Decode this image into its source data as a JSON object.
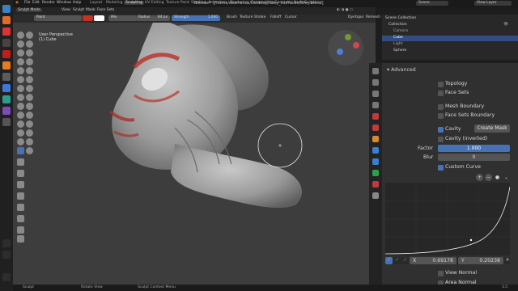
{
  "window": {
    "title": "Blender* [/home/ebarranco/Desktop/Grey_Isurfaces/Grey.blend]"
  },
  "menu": [
    "File",
    "Edit",
    "Render",
    "Window",
    "Help"
  ],
  "workspaces": [
    "Layout",
    "Modeling",
    "Sculpting",
    "UV Editing",
    "Texture Paint",
    "Shading",
    "Animation",
    "Rendering",
    "Compositing",
    "Geometry Nodes",
    "Scripting"
  ],
  "active_workspace": "Sculpting",
  "scene": {
    "label": "Scene",
    "view_layer": "View Layer"
  },
  "header1": {
    "mode": "Sculpt Mode",
    "view": "View",
    "sculpt": "Sculpt",
    "mask": "Mask",
    "face_sets": "Face Sets"
  },
  "header2": {
    "brush_name": "Paint",
    "blend": "Mix",
    "radius_label": "Radius",
    "radius_value": "84 px",
    "strength_label": "Strength",
    "strength_value": "1.000",
    "brush": "Brush",
    "texture": "Texture",
    "stroke": "Stroke",
    "falloff": "Falloff",
    "cursor": "Cursor",
    "dyntopo": "Dyntopo",
    "remesh": "Remesh",
    "color_primary": "#c8301f",
    "color_secondary": "#ffffff"
  },
  "viewport": {
    "info_line1": "User Perspective",
    "info_line2": "(1) Cube"
  },
  "outliner": {
    "items": [
      {
        "label": "Scene Collection"
      },
      {
        "label": "Collection"
      },
      {
        "label": "Camera"
      },
      {
        "label": "Cube"
      },
      {
        "label": "Light"
      },
      {
        "label": "Sphere"
      }
    ],
    "selected": "Cube"
  },
  "properties": {
    "section": "Advanced",
    "topology": "Topology",
    "face_sets": "Face Sets",
    "mesh_boundary": "Mesh Boundary",
    "face_sets_boundary": "Face Sets Boundary",
    "cavity": "Cavity",
    "create_mask": "Create Mask",
    "cavity_inverted": "Cavity (inverted)",
    "factor_label": "Factor",
    "factor_value": "1.000",
    "blur_label": "Blur",
    "blur_value": "0",
    "custom_curve": "Custom Curve",
    "curve_x_label": "X",
    "curve_x_value": "0.69178",
    "curve_y_label": "Y",
    "curve_y_value": "0.20238",
    "view_normal": "View Normal",
    "area_normal": "Area Normal",
    "checked": {
      "cavity": true,
      "custom_curve": true
    }
  },
  "status": {
    "left": "Sculpt",
    "middle": "Rotate View",
    "right": "Sculpt Context Menu",
    "version": "3.5"
  },
  "colors": {
    "accent": "#4772b3",
    "panel": "#303030",
    "viewport": "#3d3d3d"
  }
}
